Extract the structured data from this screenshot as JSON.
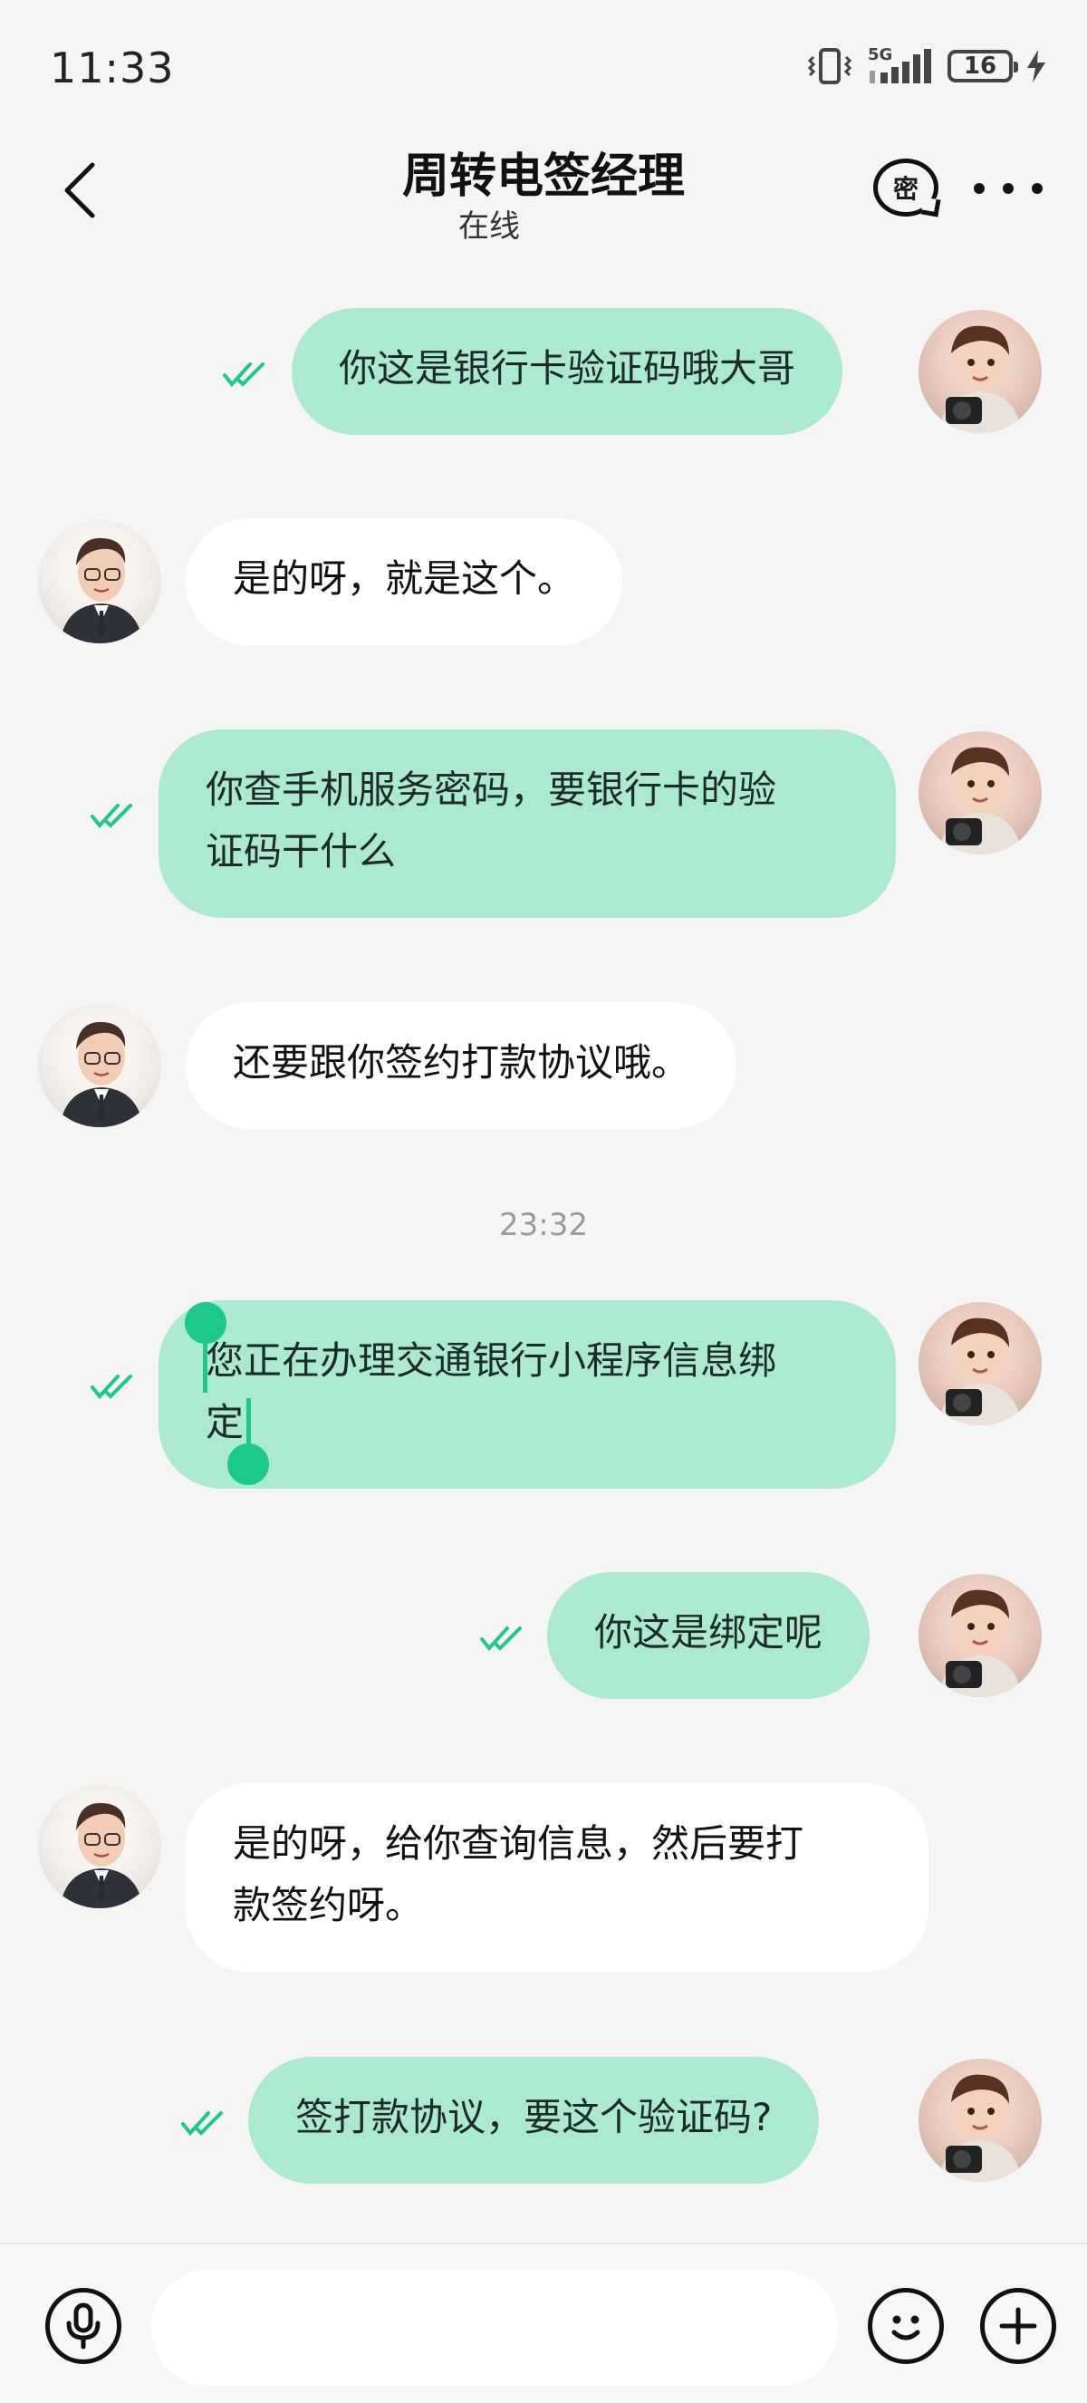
{
  "status_bar": {
    "time": "11:33",
    "network": "5G",
    "battery": "16"
  },
  "header": {
    "title": "周转电签经理",
    "subtitle": "在线",
    "secret_label": "密"
  },
  "messages": [
    {
      "from": "me",
      "text": "你这是银行卡验证码哦大哥"
    },
    {
      "from": "other",
      "text": "是的呀，就是这个。"
    },
    {
      "from": "me",
      "line1": "你查手机服务密码，要银行卡的验",
      "line2": "证码干什么"
    },
    {
      "from": "other",
      "text": "还要跟你签约打款协议哦。"
    },
    {
      "from": "me",
      "line1": "您正在办理交通银行小程序信息绑",
      "line2": "定",
      "selected": true
    },
    {
      "from": "me",
      "text": "你这是绑定呢"
    },
    {
      "from": "other",
      "line1": "是的呀，给你查询信息，然后要打",
      "line2": "款签约呀。"
    },
    {
      "from": "me",
      "text": "签打款协议，要这个验证码?"
    }
  ],
  "timestamp": "23:32",
  "input": {
    "placeholder": ""
  },
  "colors": {
    "my_bubble": "#acead0",
    "their_bubble": "#ffffff",
    "tick": "#1cc98a",
    "background": "#f5f5f5"
  },
  "icons": [
    "back-arrow-icon",
    "secret-chat-icon",
    "more-icon",
    "microphone-icon",
    "emoji-icon",
    "plus-icon",
    "read-tick-icon"
  ]
}
